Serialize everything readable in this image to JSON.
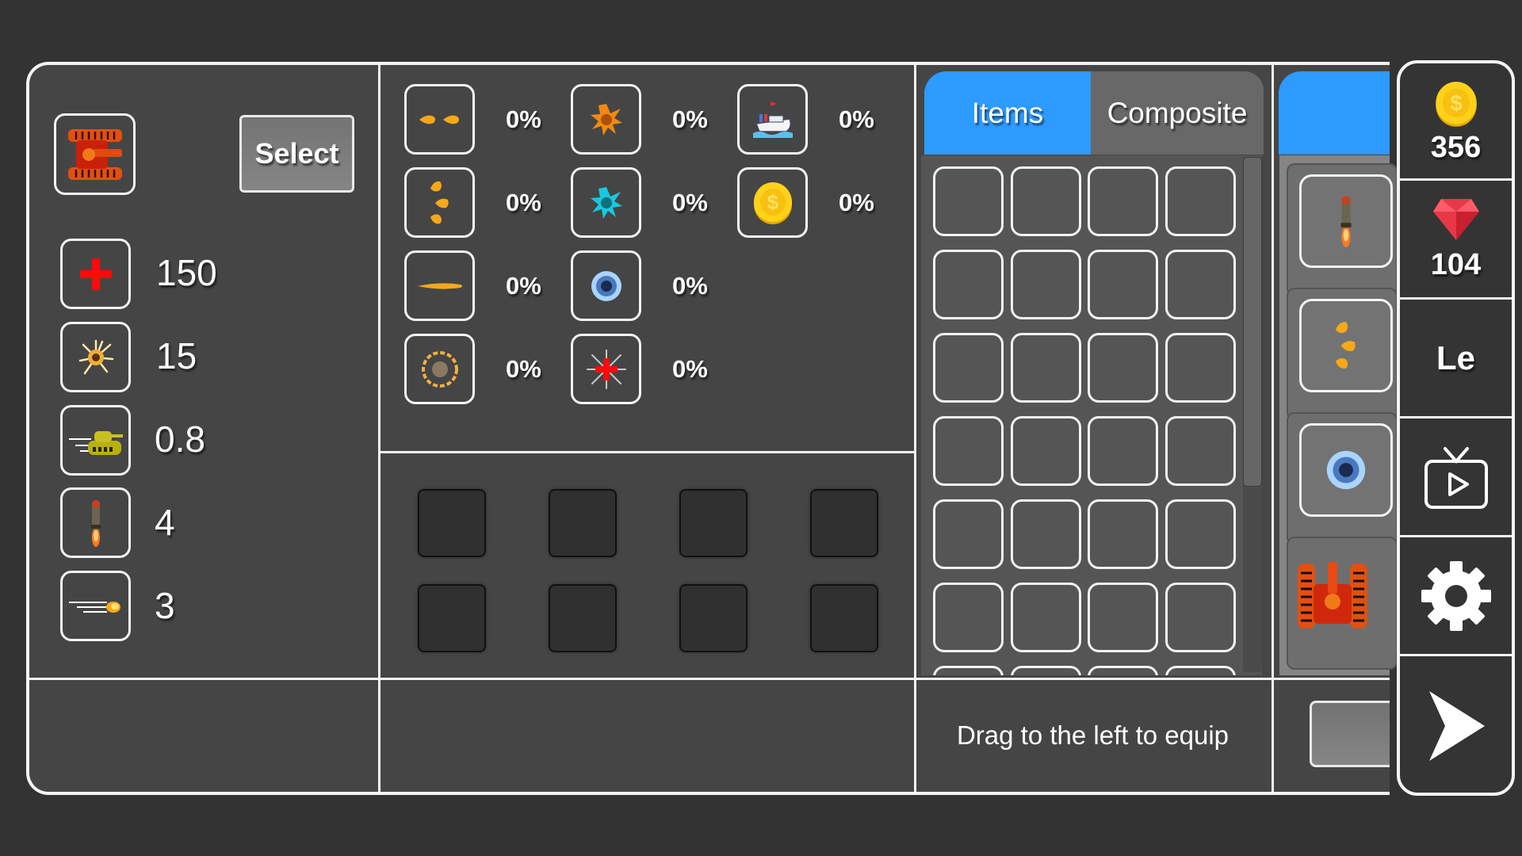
{
  "tank_card": {
    "tank_icon": "red-tank-icon",
    "select_label": "Select"
  },
  "stats": [
    {
      "icon": "health-cross-icon",
      "value": "150"
    },
    {
      "icon": "explosion-damage-icon",
      "value": "15"
    },
    {
      "icon": "tank-speed-icon",
      "value": "0.8"
    },
    {
      "icon": "rocket-icon",
      "value": "4"
    },
    {
      "icon": "bullet-speed-icon",
      "value": "3"
    }
  ],
  "skills": [
    {
      "icon": "double-bullet-icon",
      "percent": "0%"
    },
    {
      "icon": "orange-explosion-icon",
      "percent": "0%"
    },
    {
      "icon": "ship-icon",
      "percent": "0%"
    },
    {
      "icon": "triple-bullet-icon",
      "percent": "0%"
    },
    {
      "icon": "cyan-explosion-icon",
      "percent": "0%"
    },
    {
      "icon": "gold-coin-icon",
      "percent": "0%"
    },
    {
      "icon": "laser-bullet-icon",
      "percent": "0%"
    },
    {
      "icon": "ice-orb-icon",
      "percent": "0%"
    },
    {
      "icon": "fire-ring-icon",
      "percent": "0%"
    },
    {
      "icon": "heal-burst-icon",
      "percent": "0%"
    }
  ],
  "inventory": {
    "tabs": [
      {
        "label": "Items",
        "active": true
      },
      {
        "label": "Composite",
        "active": false
      }
    ],
    "hint": "Drag to the left to equip"
  },
  "equipped": [
    {
      "icon": "rocket-icon"
    },
    {
      "icon": "triple-bullet-icon"
    },
    {
      "icon": "ice-orb-icon"
    },
    {
      "icon": "red-tank-icon"
    }
  ],
  "sidebar": {
    "coins": "356",
    "gems": "104",
    "level_label": "Le"
  },
  "colors": {
    "accent": "#2d9bff",
    "background": "#333333",
    "panel": "#454545",
    "border": "#f4f4f2"
  }
}
